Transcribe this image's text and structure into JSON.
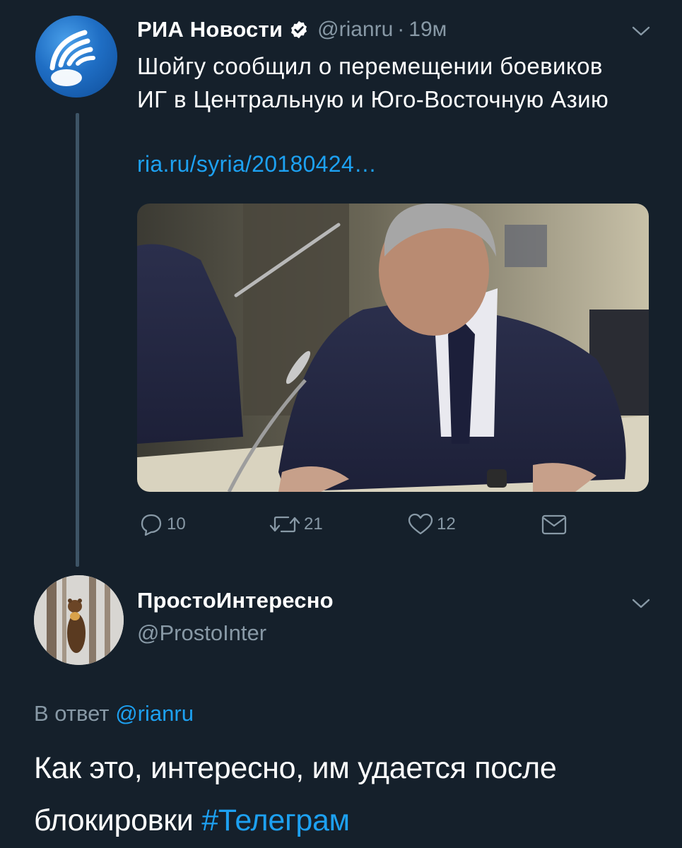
{
  "colors": {
    "background": "#15202b",
    "text_primary": "#ffffff",
    "text_secondary": "#8899a6",
    "accent_link": "#1da1f2"
  },
  "tweet": {
    "author": {
      "display_name": "РИА Новости",
      "verified": true,
      "handle": "@rianru",
      "avatar_icon": "ria-logo-icon"
    },
    "separator": "·",
    "time": "19м",
    "text": "Шойгу сообщил о перемещении боевиков ИГ в Центральную и Юго-Восточную Азию",
    "link": "ria.ru/syria/20180424…",
    "media": {
      "kind": "photo"
    },
    "actions": {
      "reply": {
        "icon": "reply-icon",
        "count": "10"
      },
      "retweet": {
        "icon": "retweet-icon",
        "count": "21"
      },
      "like": {
        "icon": "heart-icon",
        "count": "12"
      },
      "dm": {
        "icon": "mail-icon"
      }
    },
    "menu_icon": "chevron-down-icon"
  },
  "reply": {
    "author": {
      "display_name": "ПростоИнтересно",
      "handle": "@ProstoInter",
      "avatar_icon": "marten-photo-avatar"
    },
    "menu_icon": "chevron-down-icon",
    "reply_to_prefix": "В ответ",
    "reply_to_handle": "@rianru",
    "text": "Как это, интересно, им удается после блокировки",
    "hashtag": "#Телеграм"
  }
}
